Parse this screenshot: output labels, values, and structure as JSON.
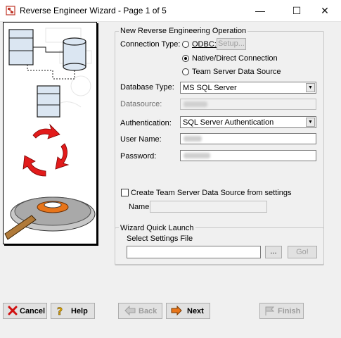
{
  "window": {
    "title": "Reverse Engineer Wizard - Page 1 of 5",
    "minimize_glyph": "—",
    "maximize_glyph": "☐",
    "close_glyph": "✕"
  },
  "operation": {
    "group_title": "New Reverse Engineering Operation",
    "connection_type_label": "Connection Type:",
    "odbc_label": "ODBC:",
    "setup_label": "Setup...",
    "native_label": "Native/Direct Connection",
    "team_server_label": "Team Server Data Source",
    "selected_connection": "Native/Direct Connection",
    "database_type_label": "Database Type:",
    "database_type_value": "MS SQL Server",
    "datasource_label": "Datasource:",
    "authentication_label": "Authentication:",
    "authentication_value": "SQL Server Authentication",
    "user_name_label": "User Name:",
    "password_label": "Password:",
    "create_ds_label": "Create Team Server Data Source from settings",
    "name_label": "Name:"
  },
  "quick_launch": {
    "group_title": "Wizard Quick Launch",
    "settings_label": "Select Settings File",
    "browse_label": "...",
    "go_label": "Go!"
  },
  "buttons": {
    "cancel": "Cancel",
    "help": "Help",
    "back": "Back",
    "next": "Next",
    "finish": "Finish"
  },
  "colors": {
    "arrow_red": "#e21b1b",
    "accent_orange": "#e8751a",
    "window_bg": "#f0f0f0"
  }
}
